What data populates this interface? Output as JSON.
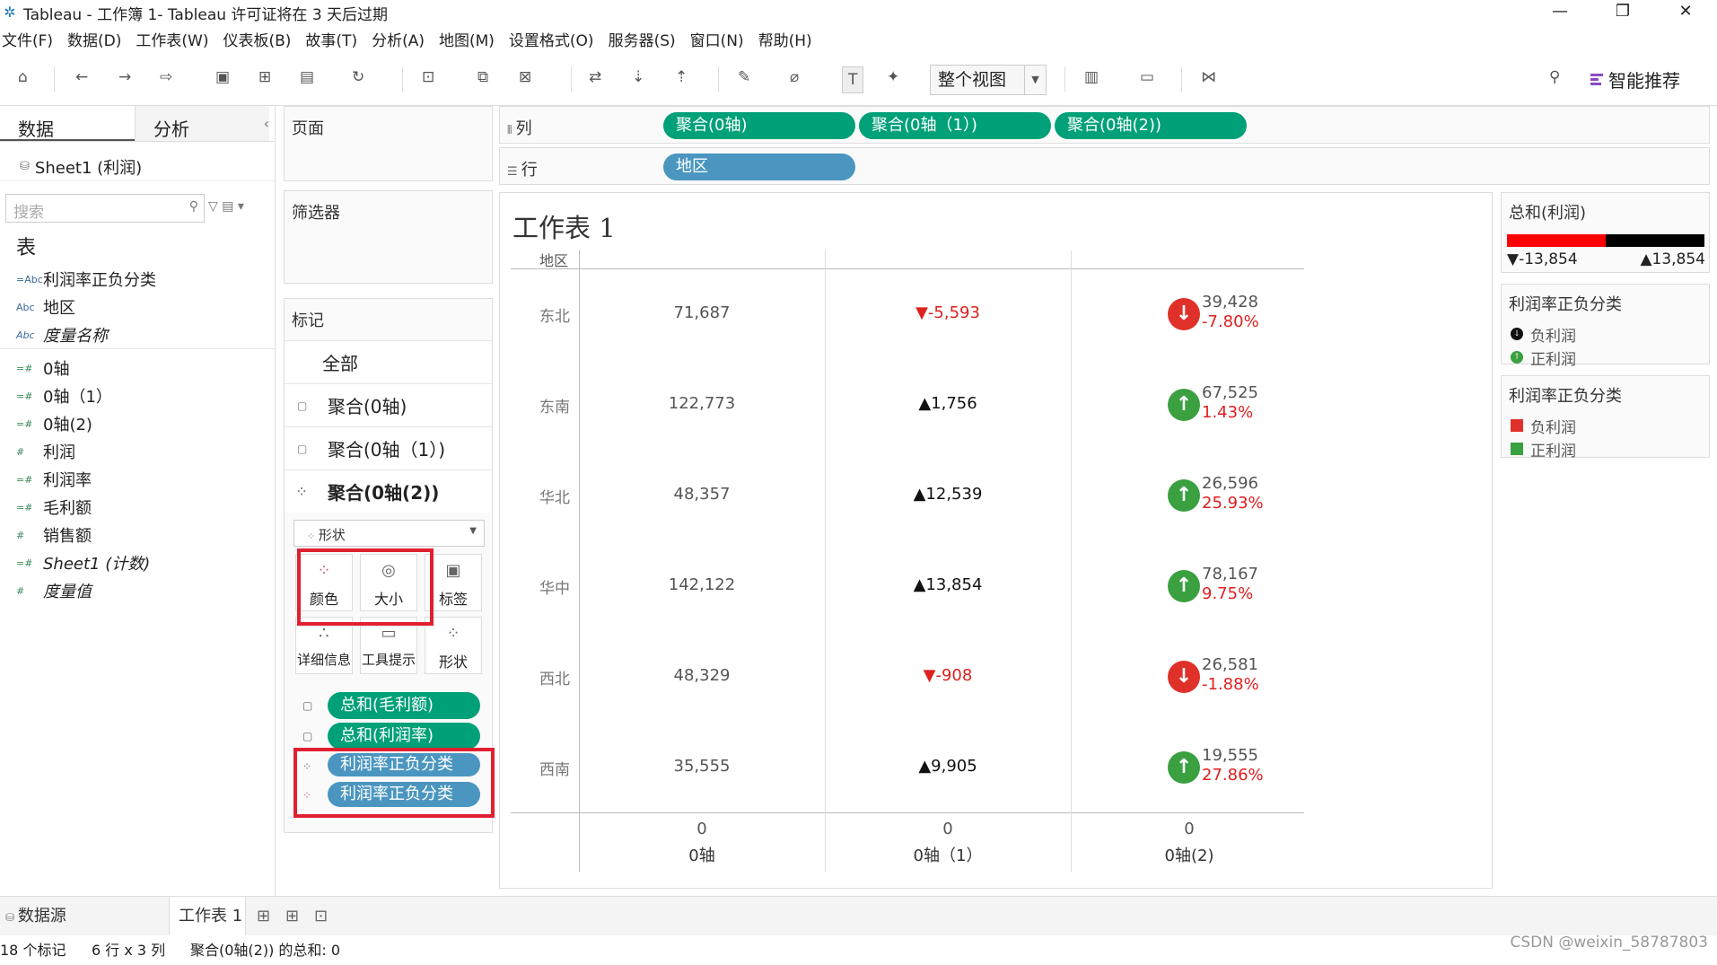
{
  "window": {
    "title": "Tableau - 工作簿 1- Tableau 许可证将在 3 天后过期",
    "minimize": "—",
    "restore": "❐",
    "close": "✕"
  },
  "menu": [
    "文件(F)",
    "数据(D)",
    "工作表(W)",
    "仪表板(B)",
    "故事(T)",
    "分析(A)",
    "地图(M)",
    "设置格式(O)",
    "服务器(S)",
    "窗口(N)",
    "帮助(H)"
  ],
  "toolbar": {
    "view_select": "整个视图",
    "smart": "智能推荐"
  },
  "left": {
    "tab_data": "数据",
    "tab_analysis": "分析",
    "datasource": "Sheet1 (利润)",
    "search_placeholder": "搜索",
    "section": "表",
    "fields": [
      {
        "name": "利润率正负分类",
        "icon": "=Abc",
        "kind": "dim"
      },
      {
        "name": "地区",
        "icon": "Abc",
        "kind": "dim"
      },
      {
        "name": "度量名称",
        "icon": "Abc",
        "kind": "dim",
        "italic": true
      },
      {
        "name": "0轴",
        "icon": "=#",
        "kind": "measure"
      },
      {
        "name": "0轴（1）",
        "icon": "=#",
        "kind": "measure"
      },
      {
        "name": "0轴(2)",
        "icon": "=#",
        "kind": "measure"
      },
      {
        "name": "利润",
        "icon": "#",
        "kind": "measure"
      },
      {
        "name": "利润率",
        "icon": "=#",
        "kind": "measure"
      },
      {
        "name": "毛利额",
        "icon": "=#",
        "kind": "measure"
      },
      {
        "name": "销售额",
        "icon": "#",
        "kind": "measure"
      },
      {
        "name": "Sheet1 (计数)",
        "icon": "=#",
        "kind": "measure",
        "italic": true
      },
      {
        "name": "度量值",
        "icon": "#",
        "kind": "measure",
        "italic": true
      }
    ]
  },
  "cards": {
    "pages": "页面",
    "filters": "筛选器",
    "marks": "标记",
    "mark_rows": [
      "全部",
      "聚合(0轴)",
      "聚合(0轴（1）)",
      "聚合(0轴(2))"
    ],
    "mark_type": "形状",
    "buttons": [
      "颜色",
      "大小",
      "标签",
      "详细信息",
      "工具提示",
      "形状"
    ],
    "pills": [
      "总和(毛利额)",
      "总和(利润率)",
      "利润率正负分类",
      "利润率正负分类"
    ]
  },
  "shelves": {
    "columns_label": "列",
    "columns": [
      "聚合(0轴)",
      "聚合(0轴（1）)",
      "聚合(0轴(2))"
    ],
    "rows_label": "行",
    "rows": [
      "地区"
    ]
  },
  "sheet": {
    "title": "工作表 1",
    "row_header": "地区",
    "rows": [
      {
        "region": "东北",
        "c1": "71,687",
        "c2": "-5,593",
        "c2_dir": "down",
        "c3": "39,428",
        "c3_pct": "-7.80%",
        "c3_dir": "down"
      },
      {
        "region": "东南",
        "c1": "122,773",
        "c2": "1,756",
        "c2_dir": "up",
        "c3": "67,525",
        "c3_pct": "1.43%",
        "c3_dir": "up"
      },
      {
        "region": "华北",
        "c1": "48,357",
        "c2": "12,539",
        "c2_dir": "up",
        "c3": "26,596",
        "c3_pct": "25.93%",
        "c3_dir": "up"
      },
      {
        "region": "华中",
        "c1": "142,122",
        "c2": "13,854",
        "c2_dir": "up",
        "c3": "78,167",
        "c3_pct": "9.75%",
        "c3_dir": "up"
      },
      {
        "region": "西北",
        "c1": "48,329",
        "c2": "-908",
        "c2_dir": "down",
        "c3": "26,581",
        "c3_pct": "-1.88%",
        "c3_dir": "down"
      },
      {
        "region": "西南",
        "c1": "35,555",
        "c2": "9,905",
        "c2_dir": "up",
        "c3": "19,555",
        "c3_pct": "27.86%",
        "c3_dir": "up"
      }
    ],
    "axis_ticks": [
      "0",
      "0",
      "0"
    ],
    "axis_names": [
      "0轴",
      "0轴（1）",
      "0轴(2)"
    ]
  },
  "legends": {
    "color_title": "总和(利润)",
    "color_min": "▼-13,854",
    "color_max": "▲13,854",
    "shape_title": "利润率正负分类",
    "shape_items": [
      "负利润",
      "正利润"
    ],
    "color2_title": "利润率正负分类",
    "color2_items": [
      "负利润",
      "正利润"
    ],
    "neg_color": "#e0302a",
    "pos_color": "#3aa040"
  },
  "bottom": {
    "datasource_tab": "数据源",
    "sheet_tab": "工作表 1"
  },
  "status": {
    "marks": "18 个标记",
    "dims": "6 行 x 3 列",
    "sum": "聚合(0轴(2)) 的总和: 0"
  },
  "watermark": "CSDN @weixin_58787803"
}
